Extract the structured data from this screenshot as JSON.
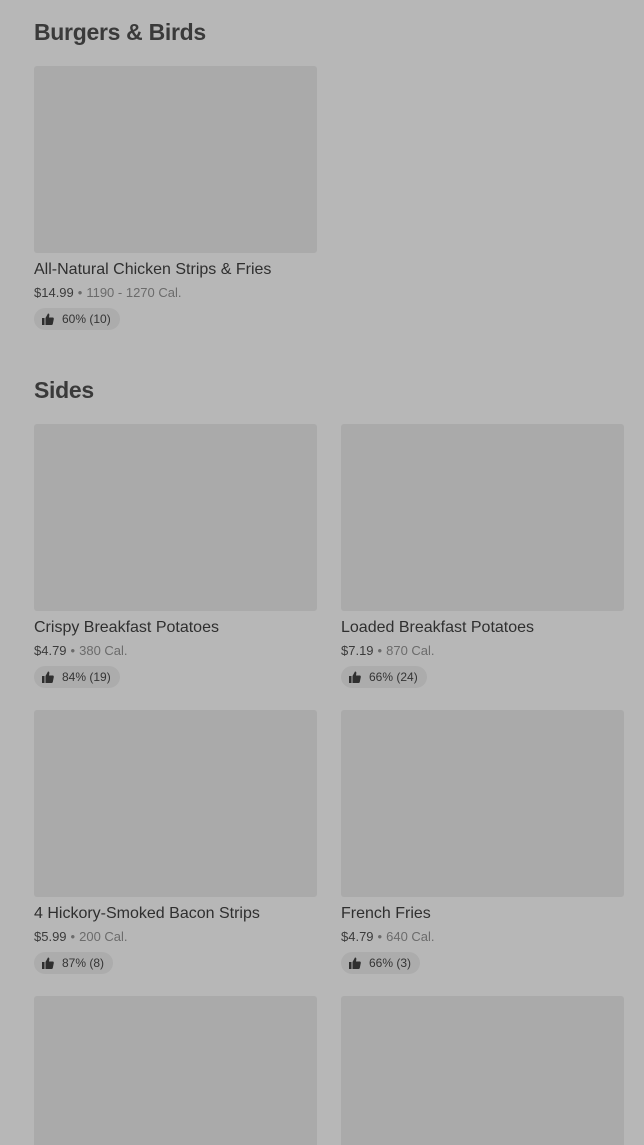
{
  "sections": [
    {
      "title": "Burgers & Birds",
      "items": [
        {
          "name": "All-Natural Chicken Strips & Fries",
          "price": "$14.99",
          "calories": "1190 - 1270 Cal.",
          "rating": "60% (10)"
        }
      ]
    },
    {
      "title": "Sides",
      "items": [
        {
          "name": "Crispy Breakfast Potatoes",
          "price": "$4.79",
          "calories": "380 Cal.",
          "rating": "84% (19)"
        },
        {
          "name": "Loaded Breakfast Potatoes",
          "price": "$7.19",
          "calories": "870 Cal.",
          "rating": "66% (24)"
        },
        {
          "name": "4 Hickory-Smoked Bacon Strips",
          "price": "$5.99",
          "calories": "200 Cal.",
          "rating": "87% (8)"
        },
        {
          "name": "French Fries",
          "price": "$4.79",
          "calories": "640 Cal.",
          "rating": "66% (3)"
        }
      ]
    }
  ],
  "separator": "•",
  "icons": {
    "rating": "thumbs-up-icon"
  },
  "colors": {
    "background": "#b7b7b7",
    "placeholder": "#aaaaaa",
    "badge": "#acacac"
  }
}
